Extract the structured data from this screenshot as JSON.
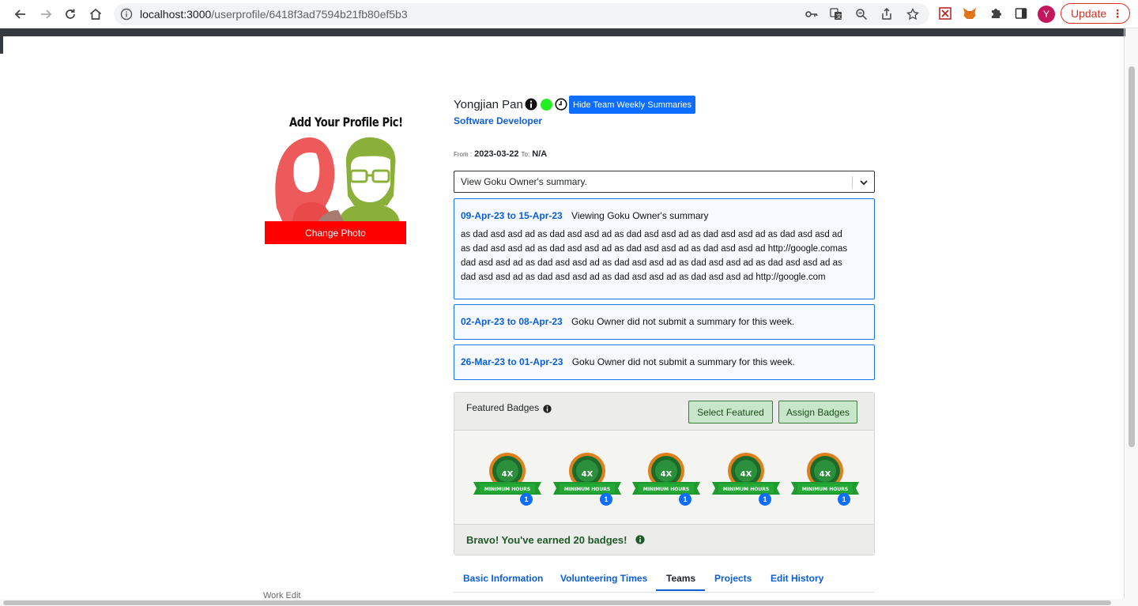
{
  "browser": {
    "url_host": "localhost:3000",
    "url_path": "/userprofile/6418f3ad7594b21fb80ef5b3",
    "avatar_letter": "Y",
    "update_label": "Update",
    "menu_glyph": "⋮"
  },
  "profile_pic": {
    "title": "Add Your Profile Pic!",
    "change_photo_label": "Change Photo",
    "partial_text": "Work Edit"
  },
  "user": {
    "name": "Yongjian Pan",
    "role": "Software Developer",
    "status_color": "#22ee22",
    "hide_summaries_label": "Hide Team Weekly Summaries",
    "from_label": "From :",
    "from_value": "2023-03-22",
    "to_label": "To:",
    "to_value": "N/A"
  },
  "summary_select": {
    "value": "View Goku Owner's summary."
  },
  "summaries": [
    {
      "range": "09-Apr-23 to 15-Apr-23",
      "title": "Viewing Goku Owner's summary",
      "lines": [
        "as dad asd asd ad as dad asd asd ad as dad asd asd ad as dad asd asd ad as dad asd asd ad",
        "as dad asd asd ad as dad asd asd ad as dad asd asd ad as dad asd asd ad http://google.comas",
        "dad asd asd ad as dad asd asd ad as dad asd asd ad as dad asd asd ad as dad asd asd ad as",
        "dad asd asd ad as dad asd asd ad as dad asd asd ad as dad asd asd ad http://google.com"
      ]
    },
    {
      "range": "02-Apr-23 to 08-Apr-23",
      "title": "Goku Owner did not submit a summary for this week."
    },
    {
      "range": "26-Mar-23 to 01-Apr-23",
      "title": "Goku Owner did not submit a summary for this week."
    }
  ],
  "badges": {
    "title": "Featured Badges",
    "select_featured_label": "Select Featured",
    "assign_badges_label": "Assign Badges",
    "items": [
      {
        "top_text": "4X",
        "ribbon_text": "MINIMUM HOURS",
        "count": "1"
      },
      {
        "top_text": "4X",
        "ribbon_text": "MINIMUM HOURS",
        "count": "1"
      },
      {
        "top_text": "4X",
        "ribbon_text": "MINIMUM HOURS",
        "count": "1"
      },
      {
        "top_text": "4X",
        "ribbon_text": "MINIMUM HOURS",
        "count": "1"
      },
      {
        "top_text": "4X",
        "ribbon_text": "MINIMUM HOURS",
        "count": "1"
      }
    ],
    "bravo_text": "Bravo! You've earned 20 badges!"
  },
  "tabs": [
    {
      "label": "Basic Information",
      "active": false
    },
    {
      "label": "Volunteering Times",
      "active": false
    },
    {
      "label": "Teams",
      "active": true
    },
    {
      "label": "Projects",
      "active": false
    },
    {
      "label": "Edit History",
      "active": false
    }
  ],
  "colors": {
    "accent": "#0d6efd",
    "link": "#0b5ed7",
    "change_photo_bg": "#ff0000",
    "badge_button_bg": "#c8e6c9",
    "summary_border": "#1a73e8"
  }
}
